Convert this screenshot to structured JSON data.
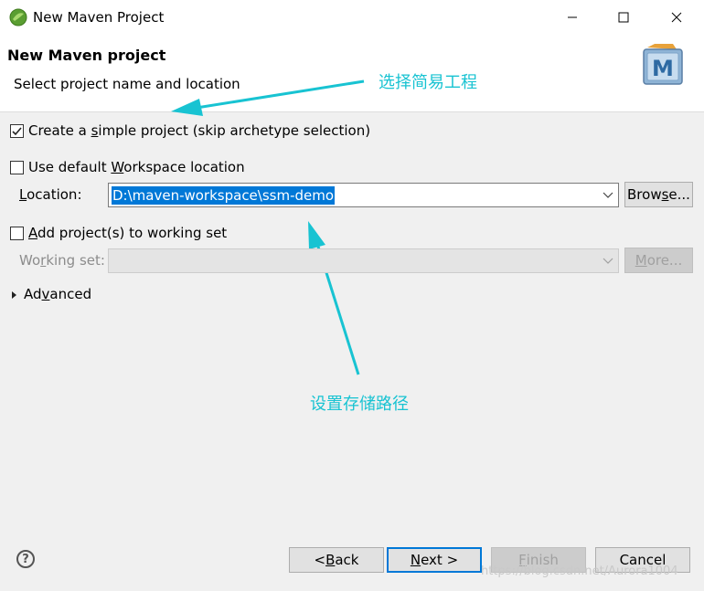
{
  "window": {
    "title": "New Maven Project",
    "icon": "eclipse-spring-icon",
    "controls": [
      "minimize-icon",
      "maximize-icon",
      "close-icon"
    ]
  },
  "header": {
    "title": "New Maven project",
    "description": "Select project name and location",
    "logo_letter": "M"
  },
  "annotations": {
    "simple_project_note": "选择简易工程",
    "location_note": "设置存储路径",
    "color": "#18c3d2"
  },
  "form": {
    "simple_project": {
      "label_pre": "Create a ",
      "label_u": "s",
      "label_post": "imple project (skip archetype selection)",
      "checked": true
    },
    "default_workspace": {
      "label_pre": "Use default ",
      "label_u": "W",
      "label_post": "orkspace location",
      "checked": false
    },
    "location": {
      "label_pre": "",
      "label_u": "L",
      "label_post": "ocation:",
      "value": "D:\\maven-workspace\\ssm-demo"
    },
    "browse_button": {
      "label_pre": "Brow",
      "label_u": "s",
      "label_post": "e..."
    },
    "working_set_check": {
      "label_pre": "",
      "label_u": "A",
      "label_post": "dd project(s) to working set",
      "checked": false
    },
    "working_set": {
      "label_pre": "Wo",
      "label_u": "r",
      "label_post": "king set:",
      "value": ""
    },
    "more_button": {
      "label_pre": "",
      "label_u": "M",
      "label_post": "ore..."
    },
    "advanced": {
      "label_pre": "Ad",
      "label_u": "v",
      "label_post": "anced"
    }
  },
  "footer": {
    "back": {
      "label_pre": "< ",
      "label_u": "B",
      "label_post": "ack"
    },
    "next": {
      "label_pre": "",
      "label_u": "N",
      "label_post": "ext >"
    },
    "finish": {
      "label_pre": "",
      "label_u": "F",
      "label_post": "inish"
    },
    "cancel": {
      "label": "Cancel"
    },
    "help_symbol": "?"
  },
  "watermark": "https://blog.csdn.net/Aurora1004"
}
